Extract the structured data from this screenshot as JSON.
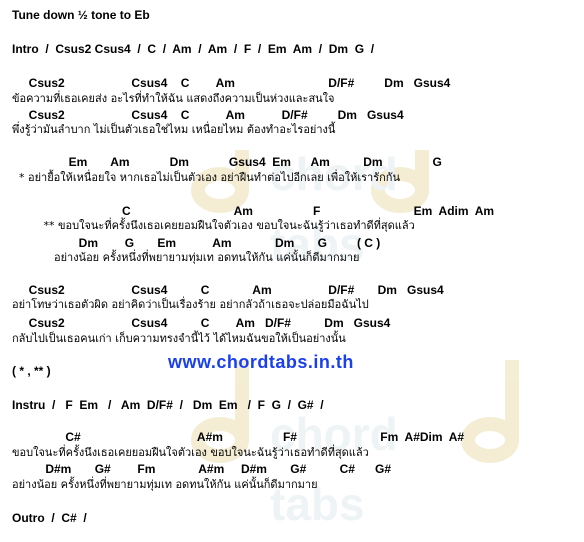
{
  "title": "Tune down ½ tone to Eb",
  "intro": "Intro  /  Csus2 Csus4  /  C  /  Am  /  Am  /  F  /  Em  Am  /  Dm  G  /",
  "verse1": [
    "     Csus2                    Csus4    C        Am                            D/F#         Dm   Gsus4",
    "ข้อความที่เธอเคยส่ง อะไรที่ทำให้ฉัน แสดงถึงความเป็นห่วงและสนใจ",
    "     Csus2                    Csus4    C           Am           D/F#         Dm   Gsus4",
    "พึ่งรู้ว่ามันลำบาก ไม่เป็นตัวเธอใช่ไหม เหนื่อยไหม ต้องทำอะไรอย่างนี้"
  ],
  "prechorus": [
    "                 Em       Am            Dm            Gsus4  Em      Am          Dm               G",
    "  * อย่ายื้อให้เหนื่อยใจ หากเธอไม่เป็นตัวเอง อย่าฝืนทำต่อไปอีกเลย เพื่อให้เรารักกัน"
  ],
  "chorus1": [
    "                                 C                               Am                  F                            Em  Adim  Am",
    "         ** ขอบใจนะที่ครั้งนึงเธอเคยยอมฝืนใจตัวเอง ขอบใจนะฉันรู้ว่าเธอทำดีที่สุดแล้ว",
    "                    Dm        G       Em           Am             Dm       G         ( C )",
    "            อย่างน้อย ครั้งหนึ่งที่พยายามทุ่มเท อดทนให้กัน แค่นั้นก็ดีมากมาย"
  ],
  "verse2": [
    "     Csus2                    Csus4          C             Am                 D/F#       Dm   Gsus4",
    "อย่าโทษว่าเธอตัวผิด อย่าคิดว่าเป็นเรื่องร้าย อย่ากลัวถ้าเธอจะปล่อยมือฉันไป",
    "     Csus2                    Csus4          C        Am   D/F#          Dm   Gsus4",
    "กลับไปเป็นเธอคนเก่า เก็บความทรงจำนี้ไว้ ได้ไหมฉันขอให้เป็นอย่างนั้น"
  ],
  "repeat": "( * , ** )",
  "website": "www.chordtabs.in.th",
  "instru": "Instru  /   F  Em   /   Am  D/F#  /   Dm  Em   /  F  G  /  G#  /",
  "chorus2": [
    "                C#                                   A#m                  F#                         Fm  A#Dim  A#",
    "ขอบใจนะที่ครั้งนึงเธอเคยยอมฝืนใจตัวเอง ขอบใจนะฉันรู้ว่าเธอทำดีที่สุดแล้ว",
    "          D#m       G#        Fm             A#m     D#m       G#          C#      G#",
    "อย่างน้อย ครั้งหนึ่งที่พยายามทุ่มเท อดทนให้กัน แค่นั้นก็ดีมากมาย"
  ],
  "outro": "Outro  /  C#  /"
}
